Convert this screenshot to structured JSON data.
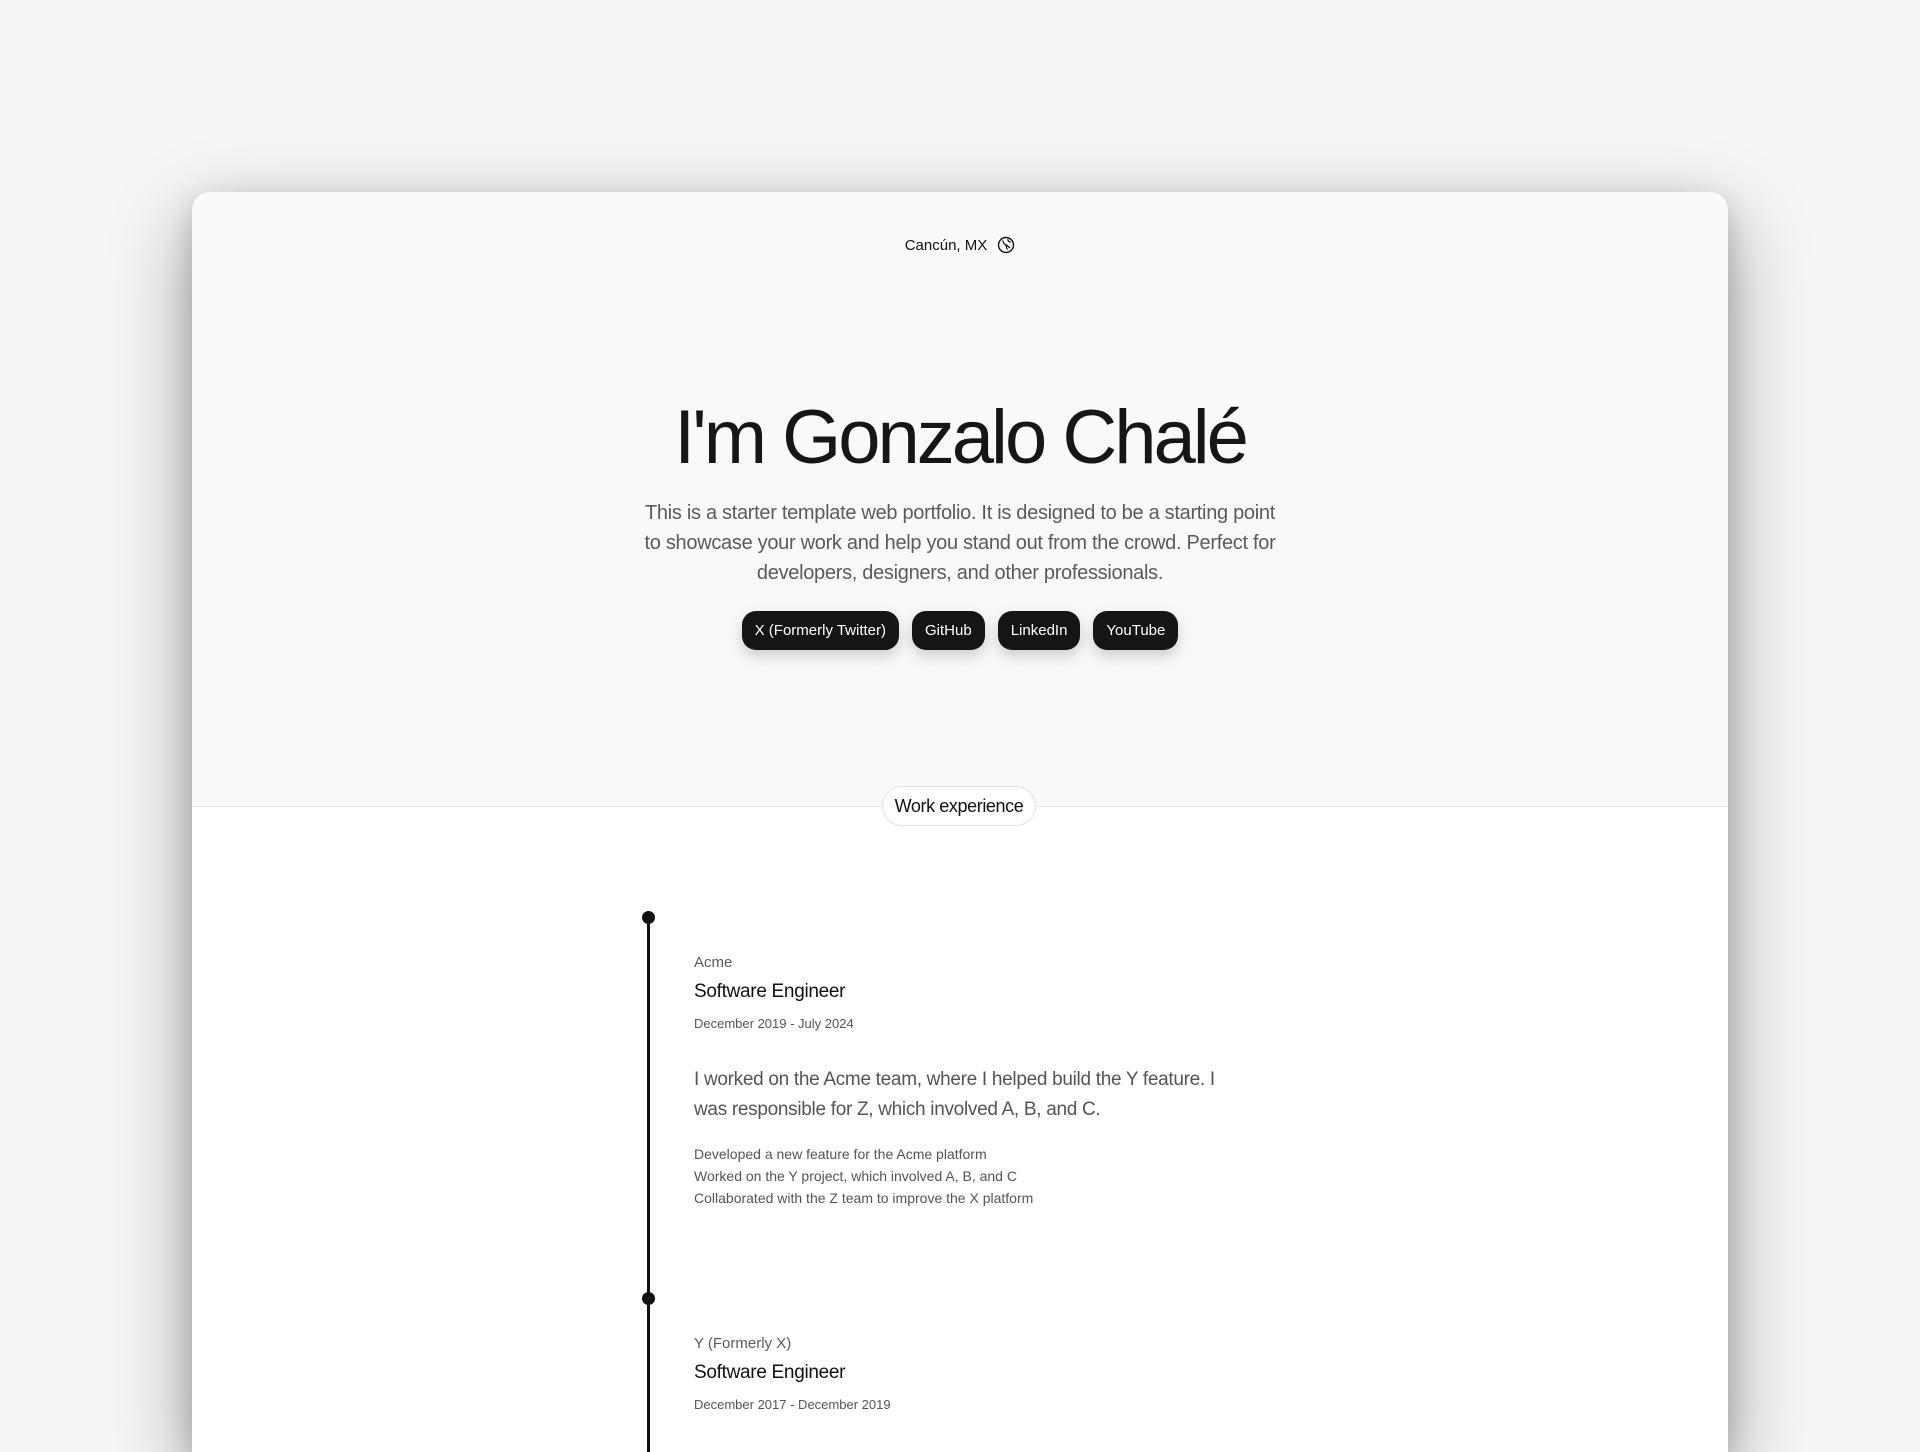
{
  "location": {
    "label": "Cancún, MX",
    "icon": "globe-icon"
  },
  "hero": {
    "title": "I'm Gonzalo Chalé",
    "description": "This is a starter template web portfolio. It is designed to be a starting point to showcase your work and help you stand out from the crowd. Perfect for developers, designers, and other professionals."
  },
  "socials": [
    {
      "label": "X (Formerly Twitter)"
    },
    {
      "label": "GitHub"
    },
    {
      "label": "LinkedIn"
    },
    {
      "label": "YouTube"
    }
  ],
  "section": {
    "label": "Work experience"
  },
  "jobs": [
    {
      "company": "Acme",
      "role": "Software Engineer",
      "dates": "December 2019 - July 2024",
      "summary": "I worked on the Acme team, where I helped build the Y feature. I was responsible for Z, which involved A, B, and C.",
      "bullets": [
        "Developed a new feature for the Acme platform",
        "Worked on the Y project, which involved A, B, and C",
        "Collaborated with the Z team to improve the X platform"
      ]
    },
    {
      "company": "Y (Formerly X)",
      "role": "Software Engineer",
      "dates": "December 2017 - December 2019"
    }
  ],
  "colors": {
    "page_bg": "#f5f5f6",
    "hero_bg": "#f9f9f9",
    "content_bg": "#ffffff",
    "button_bg": "#151515",
    "text_primary": "#111111",
    "text_muted": "#5b5b5b"
  }
}
